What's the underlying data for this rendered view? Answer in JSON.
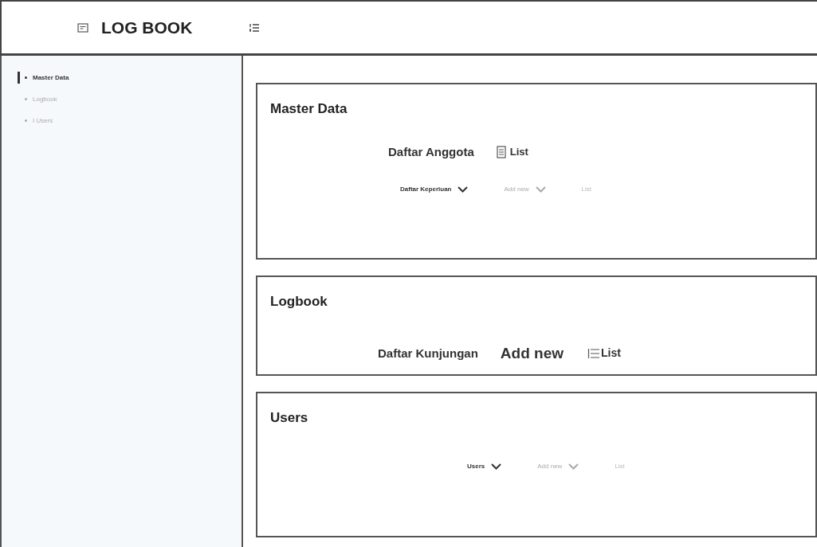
{
  "header": {
    "title": "LOG BOOK"
  },
  "sidebar": {
    "items": [
      {
        "label": "Master Data",
        "selected": true
      },
      {
        "label": "Logbook",
        "selected": false
      },
      {
        "label": "I Users",
        "selected": false
      }
    ]
  },
  "cards": [
    {
      "title": "Master Data",
      "rows": [
        [
          {
            "kind": "label",
            "text": "Daftar Anggota"
          },
          {
            "kind": "doc_link",
            "text": "List"
          }
        ],
        [
          {
            "kind": "dropdown",
            "text": "Daftar Keperluan",
            "muted": false
          },
          {
            "kind": "dropdown",
            "text": "Add new",
            "muted": true
          },
          {
            "kind": "text",
            "text": "List",
            "muted": true
          }
        ]
      ]
    },
    {
      "title": "Logbook",
      "rows": [
        [
          {
            "kind": "label",
            "text": "Daftar Kunjungan"
          },
          {
            "kind": "large",
            "text": "Add new"
          },
          {
            "kind": "list_link",
            "text": "List"
          }
        ]
      ]
    },
    {
      "title": "Users",
      "rows": [
        [
          {
            "kind": "dropdown",
            "text": "Users",
            "muted": false
          },
          {
            "kind": "dropdown",
            "text": "Add new",
            "muted": true
          },
          {
            "kind": "text",
            "text": "List",
            "muted": true
          }
        ]
      ]
    }
  ]
}
